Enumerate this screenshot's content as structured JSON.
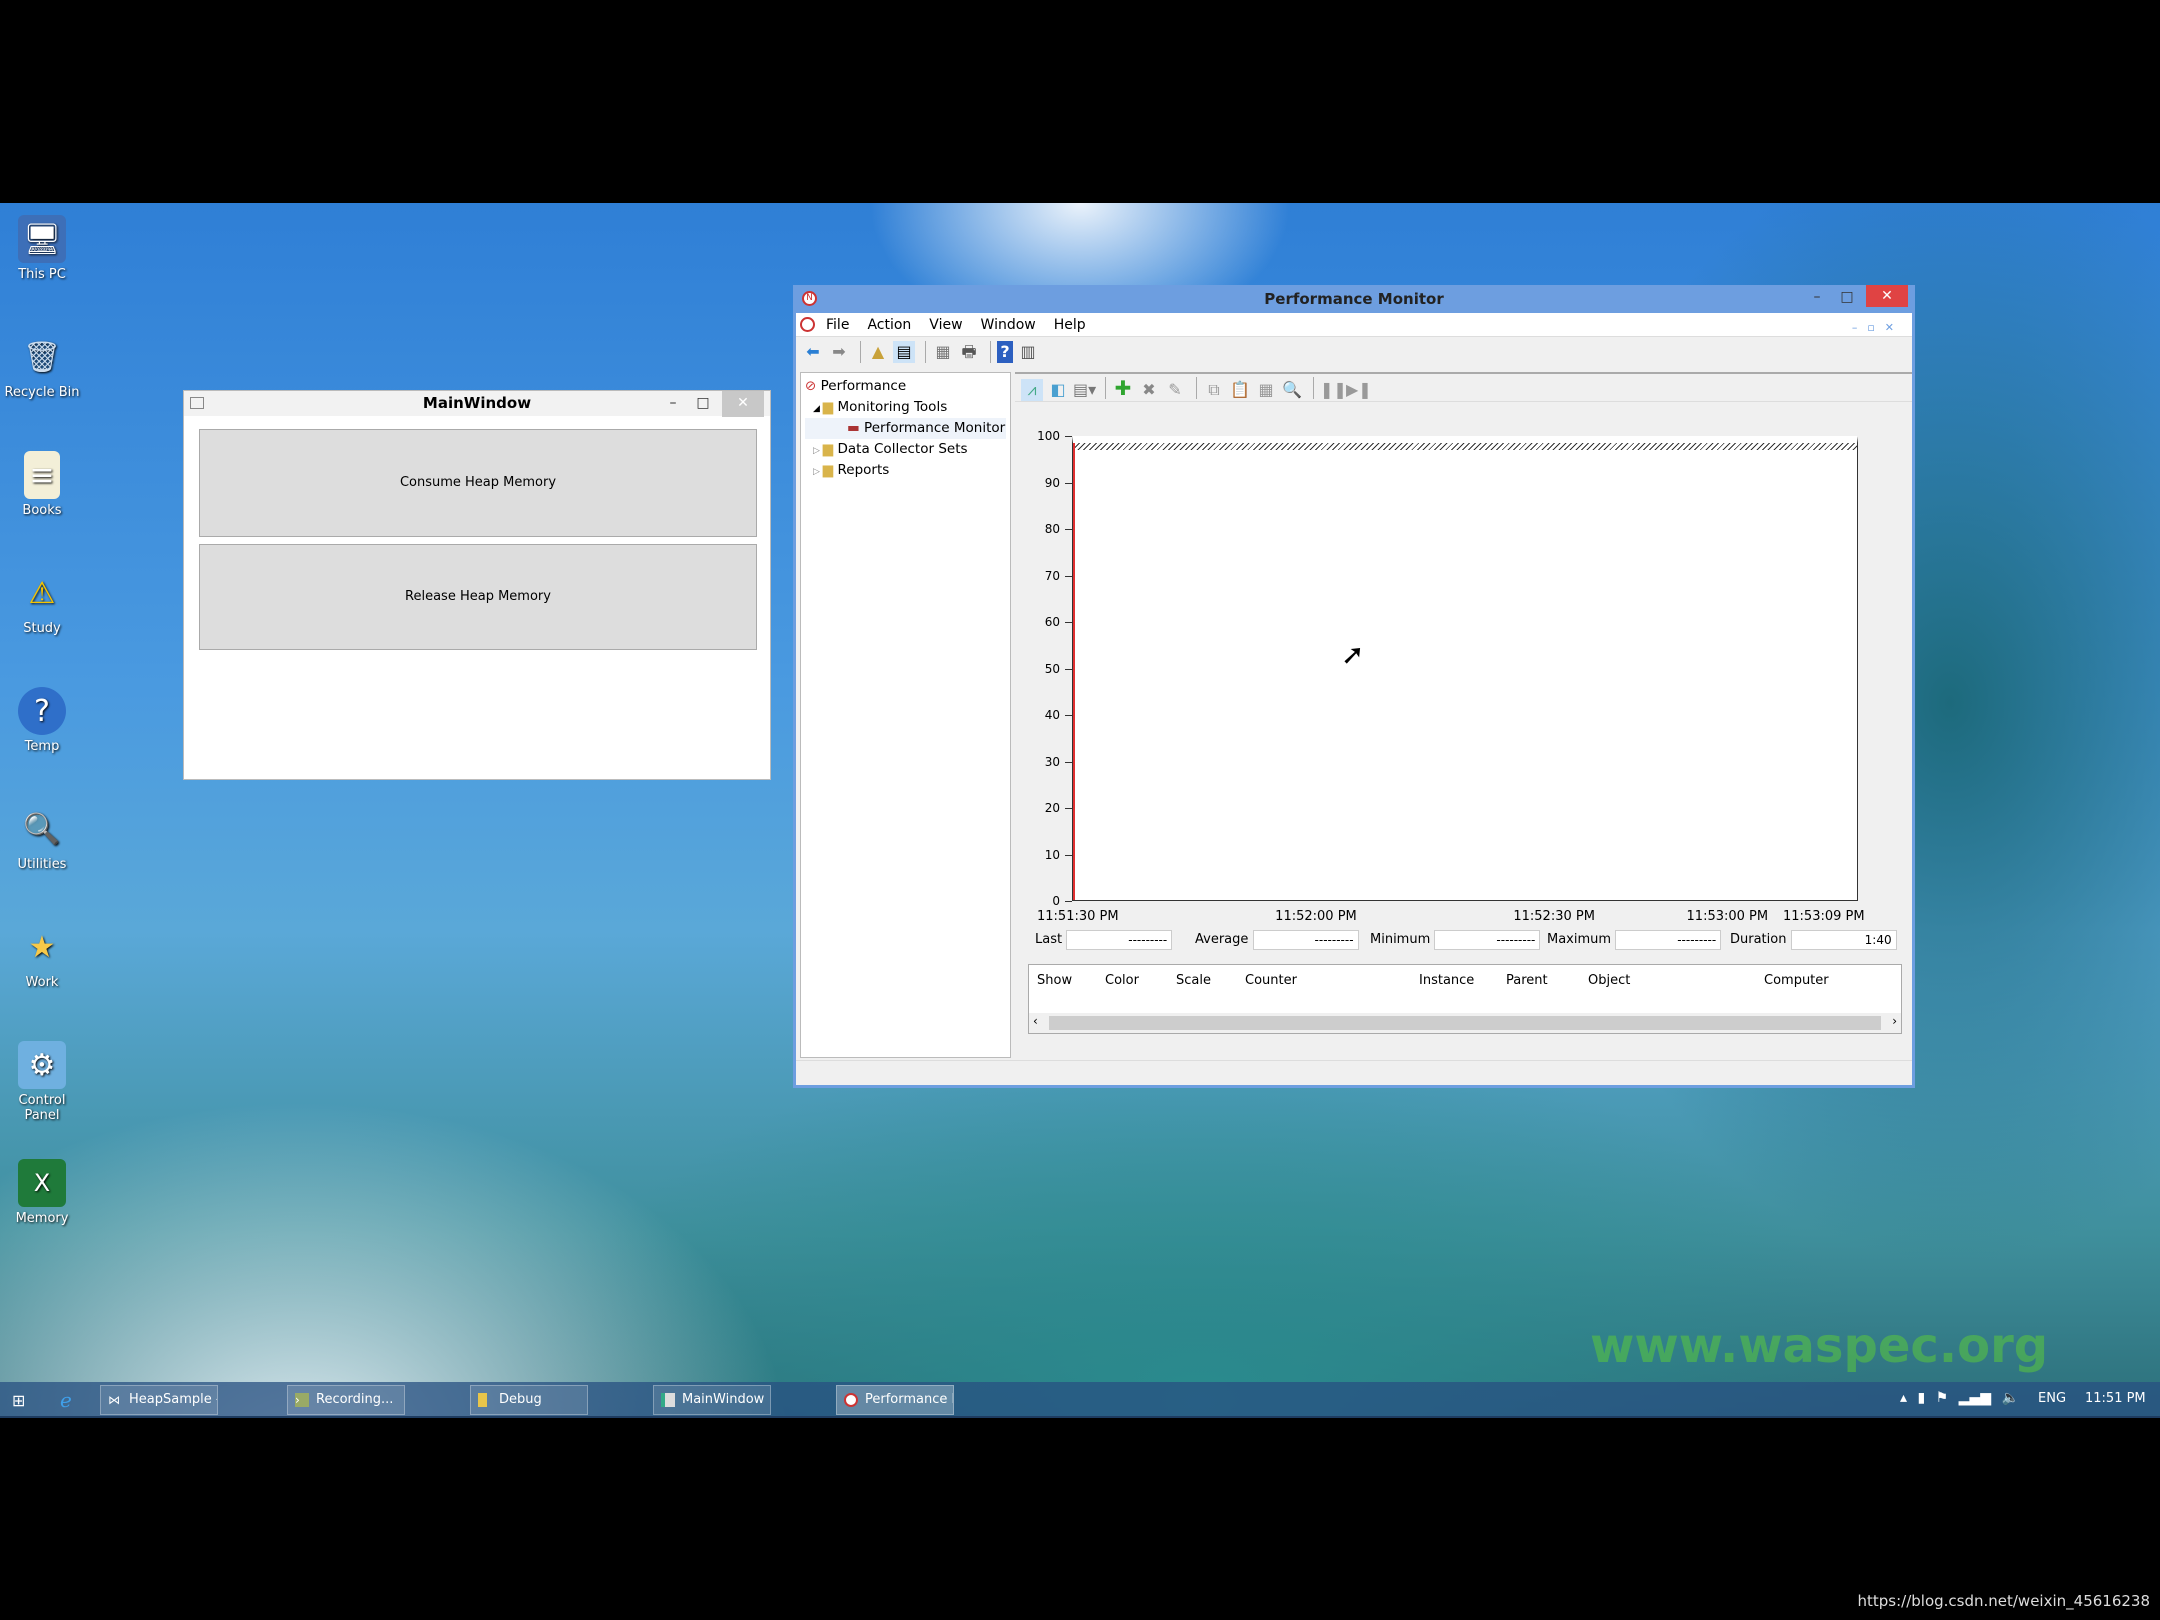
{
  "desktop": {
    "icons": [
      {
        "label": "This PC",
        "icon": "computer-icon"
      },
      {
        "label": "Recycle Bin",
        "icon": "recycle-bin-icon"
      },
      {
        "label": "Books",
        "icon": "notepad-icon"
      },
      {
        "label": "Study",
        "icon": "warning-icon"
      },
      {
        "label": "Temp",
        "icon": "help-icon"
      },
      {
        "label": "Utilities",
        "icon": "search-icon"
      },
      {
        "label": "Work",
        "icon": "folder-star-icon"
      },
      {
        "label": "Control Panel",
        "icon": "control-panel-icon"
      },
      {
        "label": "Memory",
        "icon": "excel-icon"
      }
    ],
    "watermark": "www.waspec.org"
  },
  "main_window": {
    "title": "MainWindow",
    "buttons": [
      "Consume Heap Memory",
      "Release Heap Memory"
    ]
  },
  "perfmon": {
    "title": "Performance Monitor",
    "menu": [
      "File",
      "Action",
      "View",
      "Window",
      "Help"
    ],
    "tree": {
      "root": "Performance",
      "items": [
        "Monitoring Tools",
        "Performance Monitor",
        "Data Collector Sets",
        "Reports"
      ]
    },
    "stats": {
      "last_label": "Last",
      "last": "---------",
      "average_label": "Average",
      "average": "---------",
      "minimum_label": "Minimum",
      "minimum": "---------",
      "maximum_label": "Maximum",
      "maximum": "---------",
      "duration_label": "Duration",
      "duration": "1:40"
    },
    "columns": [
      "Show",
      "Color",
      "Scale",
      "Counter",
      "Instance",
      "Parent",
      "Object",
      "Computer"
    ]
  },
  "chart_data": {
    "type": "line",
    "ylim": [
      0,
      100
    ],
    "yticks": [
      0,
      10,
      20,
      30,
      40,
      50,
      60,
      70,
      80,
      90,
      100
    ],
    "xticks": [
      "11:51:30 PM",
      "11:52:00 PM",
      "11:52:30 PM",
      "11:53:00 PM",
      "11:53:09 PM"
    ],
    "series": [],
    "grid": false,
    "cursor_color": "#e03030"
  },
  "taskbar": {
    "items": [
      "HeapSample - Micro...",
      "Recording...",
      "Debug",
      "MainWindow",
      "Performance Monitor"
    ],
    "tray": {
      "language": "ENG",
      "time": "11:51 PM"
    }
  },
  "footer_url": "https://blog.csdn.net/weixin_45616238"
}
